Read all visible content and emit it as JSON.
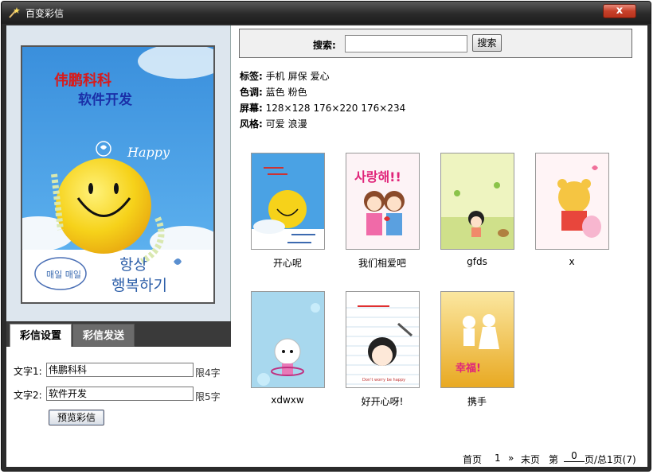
{
  "window": {
    "title": "百变彩信",
    "close_label": "x"
  },
  "left": {
    "preview_text": {
      "line1": "伟鹏科科",
      "line2": "软件开发",
      "happy": "Happy",
      "korean1": "항상",
      "korean2": "행복하기",
      "bubble": "매일 매일"
    },
    "tabs": [
      {
        "label": "彩信设置"
      },
      {
        "label": "彩信发送"
      }
    ],
    "form": {
      "text1_label": "文字1:",
      "text1_value": "伟鹏科科",
      "text1_limit": "限4字",
      "text2_label": "文字2:",
      "text2_value": "软件开发",
      "text2_limit": "限5字",
      "preview_button": "预览彩信"
    }
  },
  "search": {
    "label": "搜索:",
    "input_value": "",
    "button": "搜索"
  },
  "filters": [
    {
      "label": "标签:",
      "values": [
        "手机",
        "屏保",
        "爱心"
      ]
    },
    {
      "label": "色调:",
      "values": [
        "蓝色",
        "粉色"
      ]
    },
    {
      "label": "屏幕:",
      "values": [
        "128×128",
        "176×220",
        "176×234"
      ]
    },
    {
      "label": "风格:",
      "values": [
        "可爱",
        "浪漫"
      ]
    }
  ],
  "thumbnails": [
    {
      "caption": "开心呢"
    },
    {
      "caption": "我们相爱吧",
      "art_text": "사랑해!!"
    },
    {
      "caption": "gfds"
    },
    {
      "caption": "x"
    },
    {
      "caption": "xdwxw"
    },
    {
      "caption": "好开心呀!",
      "art_text": "Don't worry be happy"
    },
    {
      "caption": "携手",
      "art_text": "幸福!"
    }
  ],
  "pager": {
    "first": "首页",
    "current": "1",
    "next": "»",
    "last": "末页",
    "goto_prefix": "第",
    "goto_value": "0",
    "goto_suffix": "页/总1页(7)"
  },
  "colors": {
    "titlebar": "#2a2a2a",
    "sky_blue": "#3b98df",
    "smiley_yellow": "#f6d21a",
    "left_panel_bg": "#dde6ee"
  }
}
